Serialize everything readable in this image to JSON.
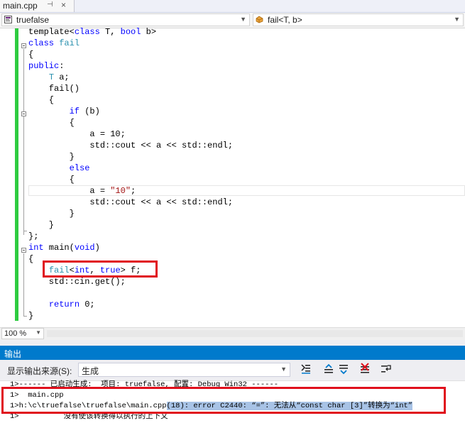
{
  "tab": {
    "title": "main.cpp",
    "pin_glyph": "⊣",
    "close_glyph": "×"
  },
  "navbar": {
    "project": "truefalse",
    "scope": "fail<T, b>",
    "project_icon": "cpp-project-icon",
    "scope_icon": "class-icon"
  },
  "code": {
    "lines": [
      [
        {
          "t": "template<",
          "c": "tf"
        },
        {
          "t": "class",
          "c": "kw"
        },
        {
          "t": " T, ",
          "c": "tf"
        },
        {
          "t": "bool",
          "c": "kw"
        },
        {
          "t": " b>",
          "c": "tf"
        }
      ],
      [
        {
          "t": "class",
          "c": "kw"
        },
        {
          "t": " ",
          "c": "tf"
        },
        {
          "t": "fail",
          "c": "ty"
        }
      ],
      [
        {
          "t": "{",
          "c": "tf"
        }
      ],
      [
        {
          "t": "public",
          "c": "kw"
        },
        {
          "t": ":",
          "c": "tf"
        }
      ],
      [
        {
          "t": "    ",
          "c": "tf"
        },
        {
          "t": "T",
          "c": "ty"
        },
        {
          "t": " a;",
          "c": "tf"
        }
      ],
      [
        {
          "t": "    fail()",
          "c": "tf"
        }
      ],
      [
        {
          "t": "    {",
          "c": "tf"
        }
      ],
      [
        {
          "t": "        ",
          "c": "tf"
        },
        {
          "t": "if",
          "c": "kw"
        },
        {
          "t": " (b)",
          "c": "tf"
        }
      ],
      [
        {
          "t": "        {",
          "c": "tf"
        }
      ],
      [
        {
          "t": "            a = 10;",
          "c": "tf"
        }
      ],
      [
        {
          "t": "            std::cout << a << std::endl;",
          "c": "tf"
        }
      ],
      [
        {
          "t": "        }",
          "c": "tf"
        }
      ],
      [
        {
          "t": "        ",
          "c": "tf"
        },
        {
          "t": "else",
          "c": "kw"
        }
      ],
      [
        {
          "t": "        {",
          "c": "tf"
        }
      ],
      [
        {
          "t": "            a = ",
          "c": "tf"
        },
        {
          "t": "\"10\"",
          "c": "str"
        },
        {
          "t": ";",
          "c": "tf"
        }
      ],
      [
        {
          "t": "            std::cout << a << std::endl;",
          "c": "tf"
        }
      ],
      [
        {
          "t": "        }",
          "c": "tf"
        }
      ],
      [
        {
          "t": "    }",
          "c": "tf"
        }
      ],
      [
        {
          "t": "};",
          "c": "tf"
        }
      ],
      [
        {
          "t": "int",
          "c": "kw"
        },
        {
          "t": " main(",
          "c": "tf"
        },
        {
          "t": "void",
          "c": "kw"
        },
        {
          "t": ")",
          "c": "tf"
        }
      ],
      [
        {
          "t": "{",
          "c": "tf"
        }
      ],
      [
        {
          "t": "    ",
          "c": "tf"
        },
        {
          "t": "fail",
          "c": "ty"
        },
        {
          "t": "<",
          "c": "tf"
        },
        {
          "t": "int",
          "c": "kw"
        },
        {
          "t": ", ",
          "c": "tf"
        },
        {
          "t": "true",
          "c": "kw"
        },
        {
          "t": "> f;",
          "c": "tf"
        }
      ],
      [
        {
          "t": "    std::cin.get();",
          "c": "tf"
        }
      ],
      [
        {
          "t": "",
          "c": "tf"
        }
      ],
      [
        {
          "t": "    ",
          "c": "tf"
        },
        {
          "t": "return",
          "c": "kw"
        },
        {
          "t": " 0;",
          "c": "tf"
        }
      ],
      [
        {
          "t": "}",
          "c": "tf"
        }
      ]
    ]
  },
  "zoom": {
    "value": "100 %"
  },
  "output": {
    "title": "输出",
    "source_label": "显示输出来源(S):",
    "source_value": "生成",
    "line0": "1>------ 已启动生成:  项目: truefalse, 配置: Debug Win32 ------",
    "line1": "1>  main.cpp",
    "line2_a": "1>h:\\c\\truefalse\\truefalse\\main.cpp",
    "line2_b": "(18): error C2440: “=”: 无法从“const char [3]”转换为“int”",
    "line3": "1>          没有使该转换得以执行的上下文"
  }
}
